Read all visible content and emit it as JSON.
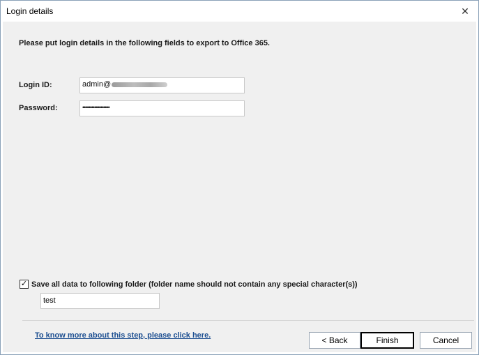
{
  "window": {
    "title": "Login details",
    "close_glyph": "✕"
  },
  "form": {
    "heading": "Please put login details in the following fields to export to Office 365.",
    "login_label": "Login ID:",
    "login_value": "admin@",
    "password_label": "Password:",
    "password_value": "••••••••••••••••••"
  },
  "folder": {
    "checkbox_checked": true,
    "checkbox_label": "Save all data to following folder (folder name should not contain any special character(s))",
    "folder_value": "test"
  },
  "footer": {
    "help_link": "To know more about this step, please click here.",
    "back_label": "< Back",
    "finish_label": "Finish",
    "cancel_label": "Cancel"
  }
}
